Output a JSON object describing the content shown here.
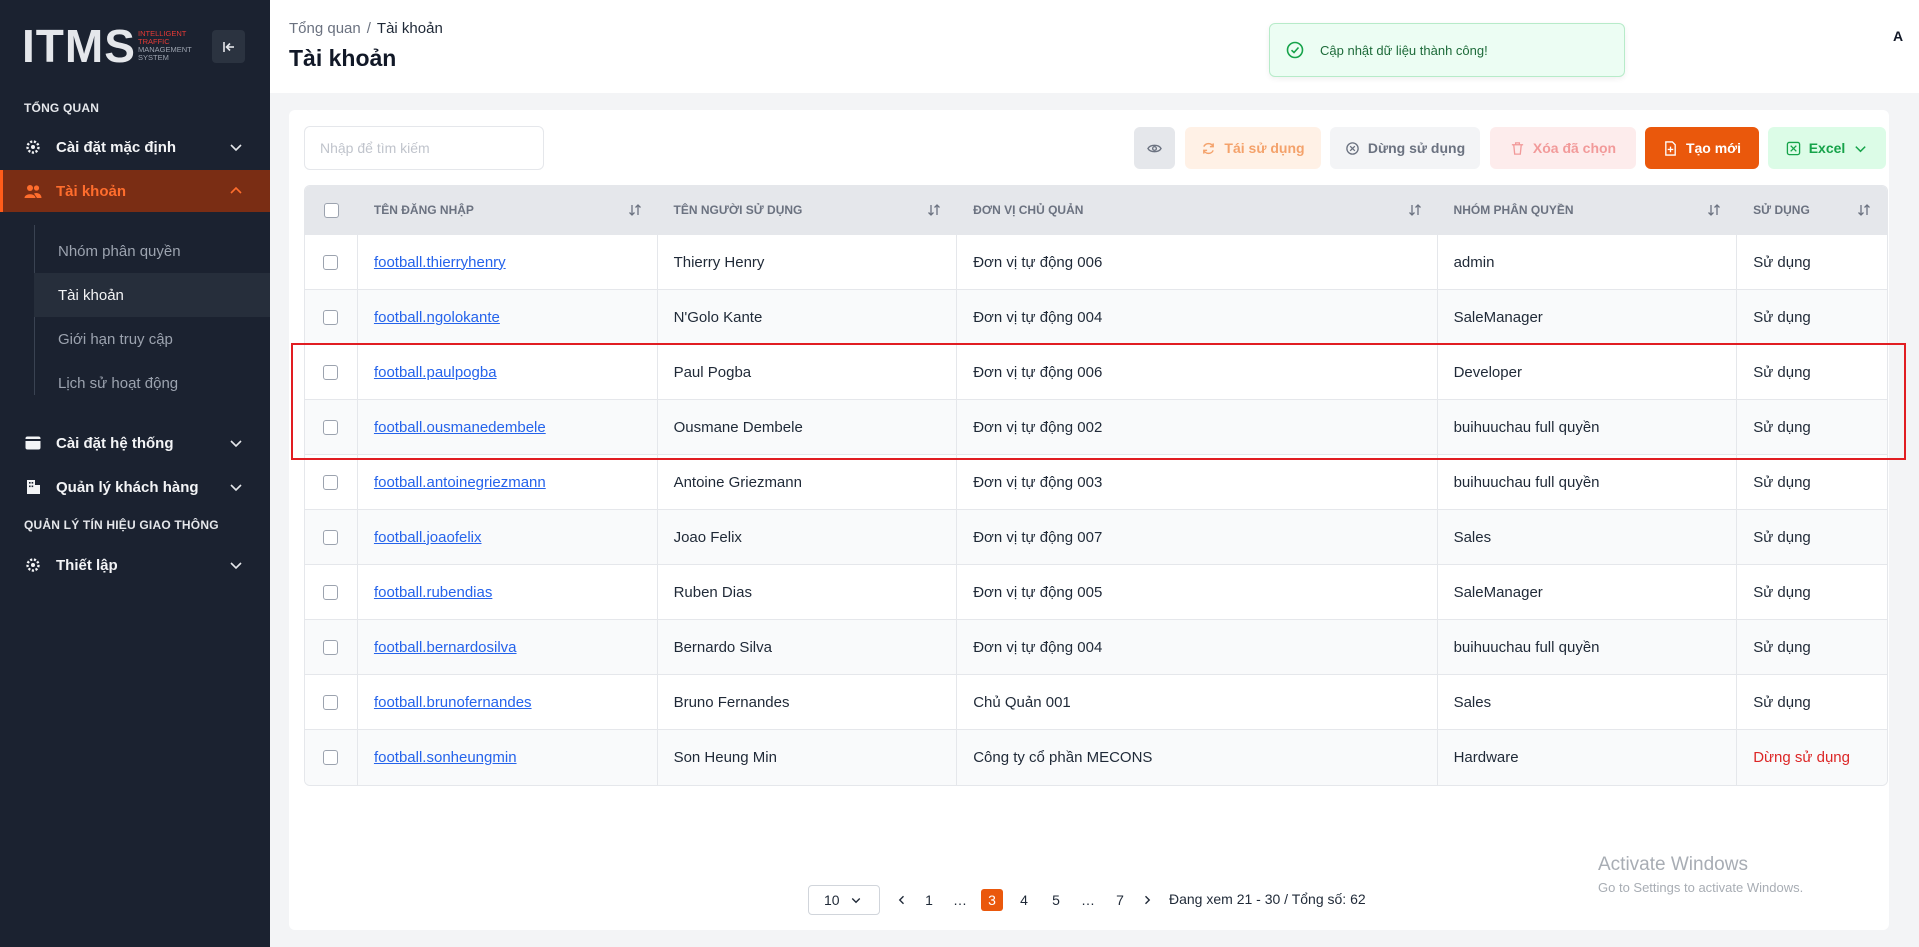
{
  "logo": {
    "text": "ITMS",
    "line1": "INTELLIGENT",
    "line2": "TRAFFIC",
    "line3": "MANAGEMENT",
    "line4": "SYSTEM"
  },
  "sidebar": {
    "section_overview": "TỔNG QUAN",
    "default_settings": "Cài đặt mặc định",
    "accounts": "Tài khoản",
    "sub_items": [
      "Nhóm phân quyền",
      "Tài khoản",
      "Giới hạn truy cập",
      "Lịch sử hoạt động"
    ],
    "system_settings": "Cài đặt hệ thống",
    "customer_mgmt": "Quản lý khách hàng",
    "section_traffic": "QUẢN LÝ TÍN HIỆU GIAO THÔNG",
    "setup": "Thiết lập"
  },
  "header": {
    "breadcrumb_root": "Tổng quan",
    "breadcrumb_sep": "/",
    "breadcrumb_current": "Tài khoản",
    "title": "Tài khoản",
    "toast": "Cập nhật dữ liệu thành công!",
    "user_initial": "A"
  },
  "toolbar": {
    "search_placeholder": "Nhập để tìm kiếm",
    "reuse": "Tái sử dụng",
    "stop": "Dừng sử dụng",
    "delete": "Xóa đã chọn",
    "create": "Tạo mới",
    "excel": "Excel"
  },
  "table": {
    "columns": [
      "TÊN ĐĂNG NHẬP",
      "TÊN NGƯỜI SỬ DỤNG",
      "ĐƠN VỊ CHỦ QUẢN",
      "NHÓM PHÂN QUYỀN",
      "SỬ DỤNG"
    ],
    "rows": [
      {
        "username": "football.thierryhenry",
        "name": "Thierry Henry",
        "unit": "Đơn vị tự động 006",
        "group": "admin",
        "status": "Sử dụng"
      },
      {
        "username": "football.ngolokante",
        "name": "N'Golo Kante",
        "unit": "Đơn vị tự động 004",
        "group": "SaleManager",
        "status": "Sử dụng"
      },
      {
        "username": "football.paulpogba",
        "name": "Paul Pogba",
        "unit": "Đơn vị tự động 006",
        "group": "Developer",
        "status": "Sử dụng"
      },
      {
        "username": "football.ousmanedembele",
        "name": "Ousmane Dembele",
        "unit": "Đơn vị tự động 002",
        "group": "buihuuchau full quyền",
        "status": "Sử dụng"
      },
      {
        "username": "football.antoinegriezmann",
        "name": "Antoine Griezmann",
        "unit": "Đơn vị tự động 003",
        "group": "buihuuchau full quyền",
        "status": "Sử dụng"
      },
      {
        "username": "football.joaofelix",
        "name": "Joao Felix",
        "unit": "Đơn vị tự động 007",
        "group": "Sales",
        "status": "Sử dụng"
      },
      {
        "username": "football.rubendias",
        "name": "Ruben Dias",
        "unit": "Đơn vị tự động 005",
        "group": "SaleManager",
        "status": "Sử dụng"
      },
      {
        "username": "football.bernardosilva",
        "name": "Bernardo Silva",
        "unit": "Đơn vị tự động 004",
        "group": "buihuuchau full quyền",
        "status": "Sử dụng"
      },
      {
        "username": "football.brunofernandes",
        "name": "Bruno Fernandes",
        "unit": "Chủ Quản 001",
        "group": "Sales",
        "status": "Sử dụng"
      },
      {
        "username": "football.sonheungmin",
        "name": "Son Heung Min",
        "unit": "Công ty cổ phần MECONS",
        "group": "Hardware",
        "status": "Dừng sử dụng"
      }
    ]
  },
  "pagination": {
    "page_size": "10",
    "pages": [
      "1",
      "…",
      "3",
      "4",
      "5",
      "…",
      "7"
    ],
    "current": "3",
    "info": "Đang xem 21 - 30 / Tổng số: 62"
  },
  "watermark": {
    "line1": "Activate Windows",
    "line2": "Go to Settings to activate Windows."
  },
  "colors": {
    "accent": "#ea580c",
    "sidebar_bg": "#1b2230",
    "link": "#2563eb",
    "danger": "#dc2626",
    "highlight": "#e11d22"
  }
}
